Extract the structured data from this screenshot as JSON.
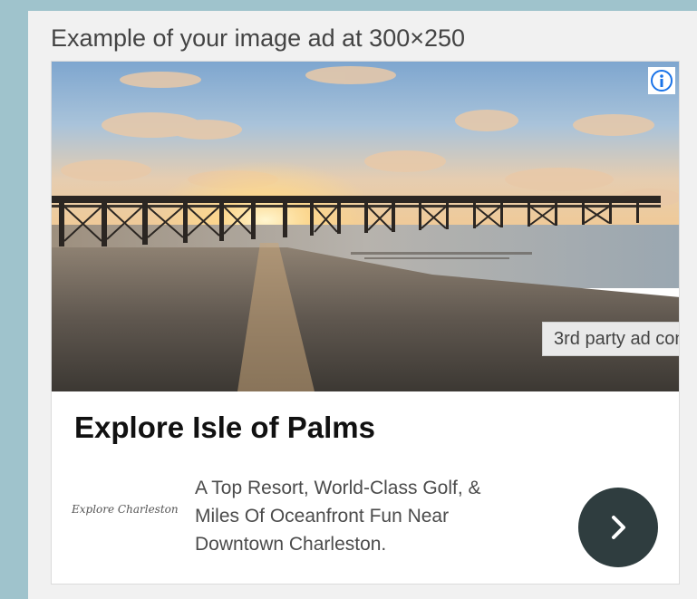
{
  "caption": "Example of your image ad at 300×250",
  "ad": {
    "third_party_label": "3rd party ad con",
    "headline": "Explore Isle of Palms",
    "logo_text": "Explore Charleston",
    "description_lines": [
      "A Top Resort, World-Class Golf, &",
      "Miles Of Oceanfront Fun Near",
      "Downtown Charleston."
    ],
    "icons": {
      "info": "info-icon",
      "cta": "chevron-right-icon"
    }
  },
  "colors": {
    "page_background": "#9fc3cc",
    "info_icon": "#1a73e8",
    "cta_button": "#2f3d3f"
  }
}
